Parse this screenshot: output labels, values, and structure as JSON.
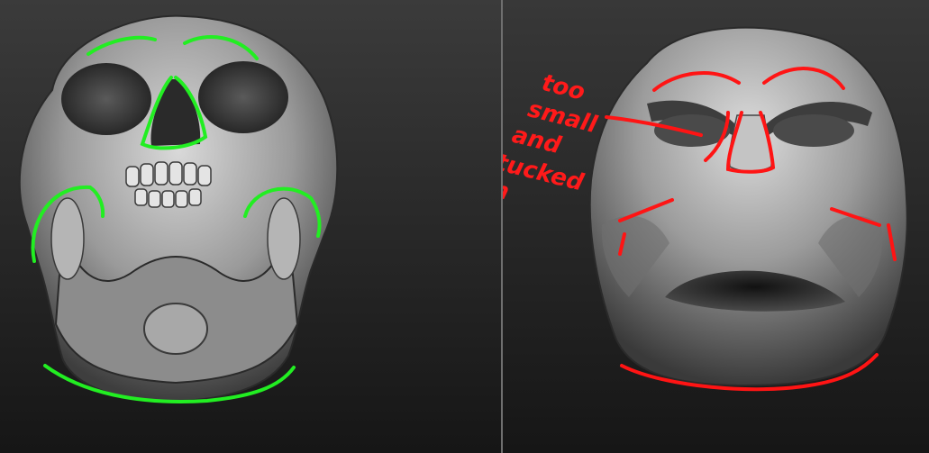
{
  "colors": {
    "background_top": "#3a3a3a",
    "background_bottom": "#161616",
    "divider": "#6f6f6f",
    "green_annotation": "#22ee22",
    "red_annotation": "#ff1414",
    "sculpt_light": "#d8d8d8",
    "sculpt_mid": "#8a8a8a",
    "sculpt_dark": "#1c1c1c"
  },
  "left_view": {
    "subject": "skull-reference"
  },
  "right_view": {
    "subject": "face-sculpt"
  },
  "annotation": {
    "lines": [
      "too",
      "small",
      "and",
      "tucked",
      "in"
    ]
  }
}
